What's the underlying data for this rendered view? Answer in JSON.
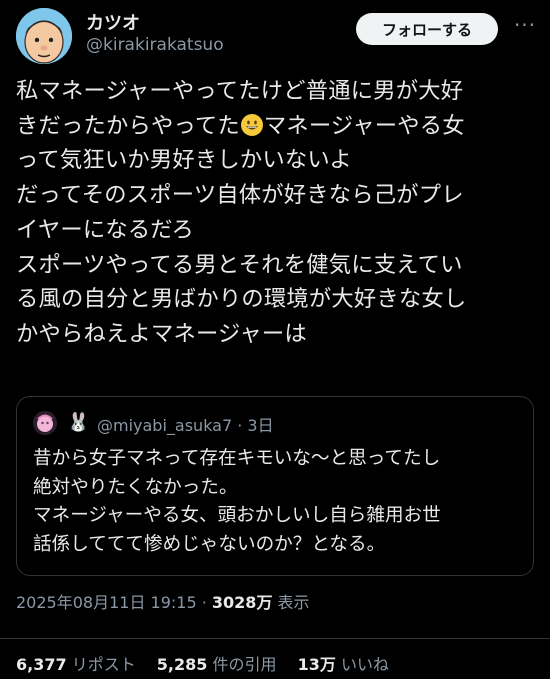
{
  "header": {
    "display_name": "カツオ",
    "handle": "@kirakirakatsuo",
    "follow_label": "フォローする",
    "more_label": "···"
  },
  "tweet": {
    "line1": "私マネージャーやってたけど普通に男が大好",
    "line2a": "きだったからやってた",
    "line2b": "マネージャーやる女",
    "line3": "って気狂いか男好きしかいないよ",
    "line4": "だってそのスポーツ自体が好きなら己がプレ",
    "line5": "イヤーになるだろ",
    "line6": "スポーツやってる男とそれを健気に支えてい",
    "line7": "る風の自分と男ばかりの環境が大好きな女し",
    "line8": "かやらねえよマネージャーは",
    "emoji": "grinning-face-emoji"
  },
  "quote": {
    "rabbit": "🐰",
    "handle": "@miyabi_asuka7 · 3日",
    "line1": "昔から女子マネって存在キモいな〜と思ってたし",
    "line2": "絶対やりたくなかった。",
    "line3": "マネージャーやる女、頭おかしいし自ら雑用お世",
    "line4": "話係しててて惨めじゃないのか？となる。"
  },
  "meta": {
    "timestamp": "2025年08月11日 19:15 · ",
    "views": "3028万",
    "views_label": " 表示"
  },
  "stats": {
    "reposts": "6,377",
    "reposts_label": " リポスト",
    "quotes": "5,285",
    "quotes_label": " 件の引用",
    "likes": "13万",
    "likes_label": " いいね"
  },
  "colors": {
    "background": "#000000",
    "text": "#e7e9ea",
    "secondary": "#8b98a5",
    "border": "#2f3336",
    "button_bg": "#eff3f4"
  }
}
